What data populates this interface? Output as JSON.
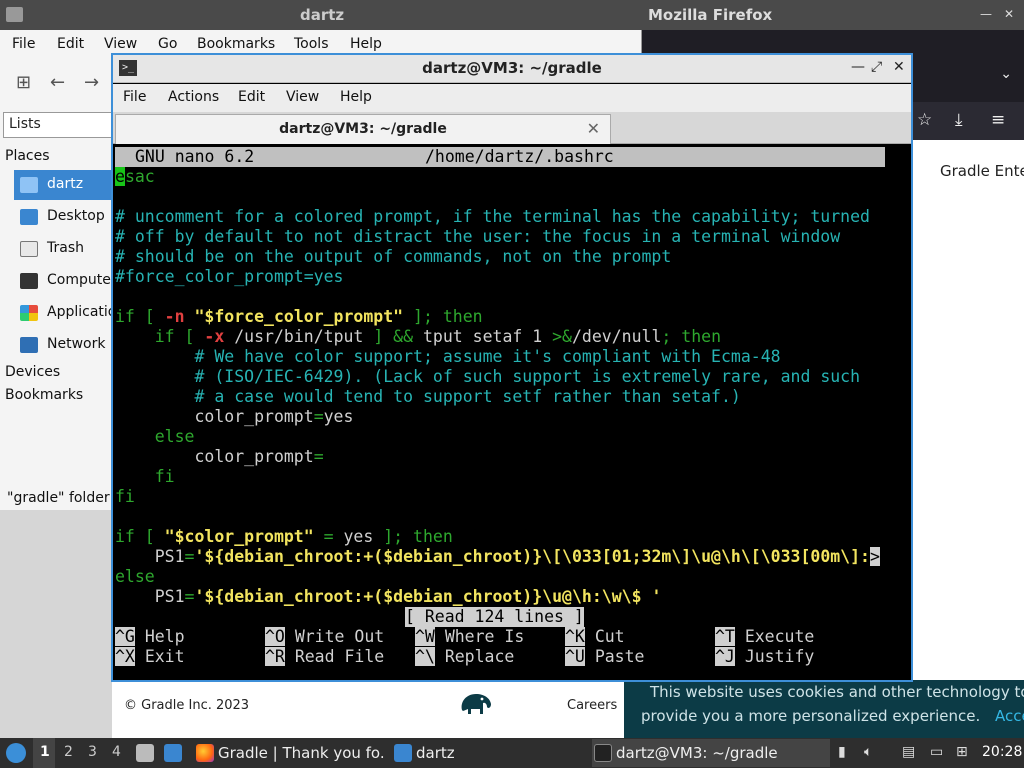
{
  "firefox": {
    "title": "Mozilla Firefox",
    "page_heading": "Gradle Ente",
    "footer_copyright": "© Gradle Inc. 2023",
    "footer_careers": "Careers",
    "cookie_line1": "This website uses cookies and other technology to",
    "cookie_line2": "provide you a more personalized experience.",
    "cookie_accept": "Accept",
    "colors": {
      "cookie_bg": "#0c3b46",
      "accept": "#34b7e4"
    }
  },
  "file_manager": {
    "title": "dartz",
    "menu": [
      "File",
      "Edit",
      "View",
      "Go",
      "Bookmarks",
      "Tools",
      "Help"
    ],
    "side_lists": "Lists",
    "places_header": "Places",
    "places": [
      {
        "label": "dartz",
        "icon": "home-folder-icon"
      },
      {
        "label": "Desktop",
        "icon": "desktop-icon"
      },
      {
        "label": "Trash",
        "icon": "trash-icon"
      },
      {
        "label": "Computer",
        "icon": "computer-icon"
      },
      {
        "label": "Applications",
        "icon": "applications-icon"
      },
      {
        "label": "Network",
        "icon": "network-icon"
      }
    ],
    "devices_header": "Devices",
    "bookmarks_header": "Bookmarks",
    "status": "\"gradle\" folder"
  },
  "terminal": {
    "title": "dartz@VM3: ~/gradle",
    "menu": [
      "File",
      "Actions",
      "Edit",
      "View",
      "Help"
    ],
    "tab_label": "dartz@VM3: ~/gradle",
    "nano": {
      "version": "GNU nano 6.2",
      "file_path": "/home/dartz/.bashrc",
      "status_message": "[ Read 124 lines ]",
      "shortcuts": [
        {
          "key": "^G",
          "label": "Help"
        },
        {
          "key": "^O",
          "label": "Write Out"
        },
        {
          "key": "^W",
          "label": "Where Is"
        },
        {
          "key": "^K",
          "label": "Cut"
        },
        {
          "key": "^T",
          "label": "Execute"
        },
        {
          "key": "^X",
          "label": "Exit"
        },
        {
          "key": "^R",
          "label": "Read File"
        },
        {
          "key": "^\\",
          "label": "Replace"
        },
        {
          "key": "^U",
          "label": "Paste"
        },
        {
          "key": "^J",
          "label": "Justify"
        }
      ],
      "lines": [
        [
          [
            "cur",
            "e"
          ],
          [
            "kw",
            "sac"
          ]
        ],
        [],
        [
          [
            "cm",
            "# uncomment for a colored prompt, if the terminal has the capability; turned"
          ]
        ],
        [
          [
            "cm",
            "# off by default to not distract the user: the focus in a terminal window"
          ]
        ],
        [
          [
            "cm",
            "# should be on the output of commands, not on the prompt"
          ]
        ],
        [
          [
            "cm",
            "#force_color_prompt=yes"
          ]
        ],
        [],
        [
          [
            "kw",
            "if [ "
          ],
          [
            "fl",
            "-n"
          ],
          [
            "pl",
            " "
          ],
          [
            "st",
            "\"$force_color_prompt\""
          ],
          [
            "pl",
            " "
          ],
          [
            "kw",
            "]; then"
          ]
        ],
        [
          [
            "pl",
            "    "
          ],
          [
            "kw",
            "if [ "
          ],
          [
            "fl",
            "-x"
          ],
          [
            "pl",
            " /usr/bin/tput "
          ],
          [
            "kw",
            "] && "
          ],
          [
            "pl",
            "tput setaf 1 "
          ],
          [
            "kw",
            ">&"
          ],
          [
            "pl",
            "/dev/null"
          ],
          [
            "kw",
            "; then"
          ]
        ],
        [
          [
            "pl",
            "        "
          ],
          [
            "cm",
            "# We have color support; assume it's compliant with Ecma-48"
          ]
        ],
        [
          [
            "pl",
            "        "
          ],
          [
            "cm",
            "# (ISO/IEC-6429). (Lack of such support is extremely rare, and such"
          ]
        ],
        [
          [
            "pl",
            "        "
          ],
          [
            "cm",
            "# a case would tend to support setf rather than setaf.)"
          ]
        ],
        [
          [
            "pl",
            "        color_prompt"
          ],
          [
            "kw",
            "="
          ],
          [
            "pl",
            "yes"
          ]
        ],
        [
          [
            "pl",
            "    "
          ],
          [
            "kw",
            "else"
          ]
        ],
        [
          [
            "pl",
            "        color_prompt"
          ],
          [
            "kw",
            "="
          ]
        ],
        [
          [
            "pl",
            "    "
          ],
          [
            "kw",
            "fi"
          ]
        ],
        [
          [
            "kw",
            "fi"
          ]
        ],
        [],
        [
          [
            "kw",
            "if [ "
          ],
          [
            "st",
            "\"$color_prompt\""
          ],
          [
            "pl",
            " "
          ],
          [
            "kw",
            "="
          ],
          [
            "pl",
            " yes "
          ],
          [
            "kw",
            "]; then"
          ]
        ],
        [
          [
            "pl",
            "    PS1"
          ],
          [
            "kw",
            "="
          ],
          [
            "ps",
            "'${debian_chroot:+($debian_chroot)}\\[\\033[01;32m\\]\\u@\\h\\[\\033[00m\\]:"
          ],
          [
            "trunc",
            ">"
          ]
        ],
        [
          [
            "kw",
            "else"
          ]
        ],
        [
          [
            "pl",
            "    PS1"
          ],
          [
            "kw",
            "="
          ],
          [
            "ps",
            "'${debian_chroot:+($debian_chroot)}\\u@\\h:\\w\\$ '"
          ]
        ]
      ]
    }
  },
  "taskbar": {
    "workspaces": [
      "1",
      "2",
      "3",
      "4"
    ],
    "tasks": [
      {
        "label": "Gradle | Thank you fo...",
        "icon": "firefox-icon"
      },
      {
        "label": "dartz",
        "icon": "folder-icon"
      },
      {
        "label": "dartz@VM3: ~/gradle",
        "icon": "terminal-icon"
      }
    ],
    "clock": "20:28"
  }
}
